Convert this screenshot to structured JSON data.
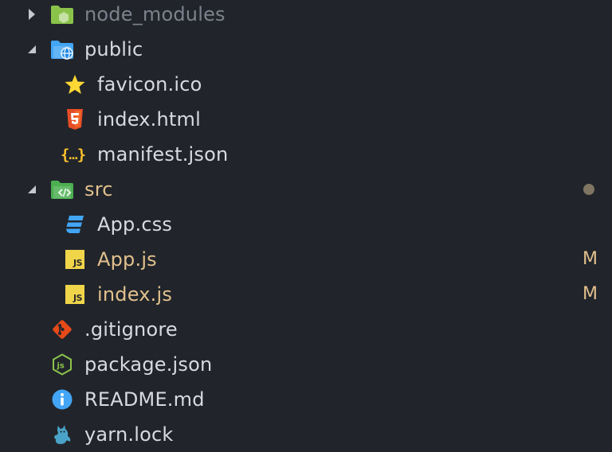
{
  "explorer": {
    "items": [
      {
        "label": "node_modules",
        "icon": "node-modules-folder-icon",
        "expanded": false,
        "dimmed": true
      },
      {
        "label": "public",
        "icon": "public-folder-icon",
        "expanded": true
      },
      {
        "label": "favicon.ico",
        "icon": "star-icon"
      },
      {
        "label": "index.html",
        "icon": "html5-icon"
      },
      {
        "label": "manifest.json",
        "icon": "json-braces-icon"
      },
      {
        "label": "src",
        "icon": "src-folder-icon",
        "expanded": true,
        "status": "modified-dot"
      },
      {
        "label": "App.css",
        "icon": "css3-icon"
      },
      {
        "label": "App.js",
        "icon": "javascript-icon",
        "status": "M"
      },
      {
        "label": "index.js",
        "icon": "javascript-icon",
        "status": "M"
      },
      {
        "label": ".gitignore",
        "icon": "git-icon"
      },
      {
        "label": "package.json",
        "icon": "nodejs-icon"
      },
      {
        "label": "README.md",
        "icon": "info-icon"
      },
      {
        "label": "yarn.lock",
        "icon": "yarn-cat-icon"
      }
    ]
  },
  "colors": {
    "background": "#21252b",
    "text": "#d7dae0",
    "dimmed_text": "#7c828d",
    "modified_text": "#e2c08d"
  }
}
